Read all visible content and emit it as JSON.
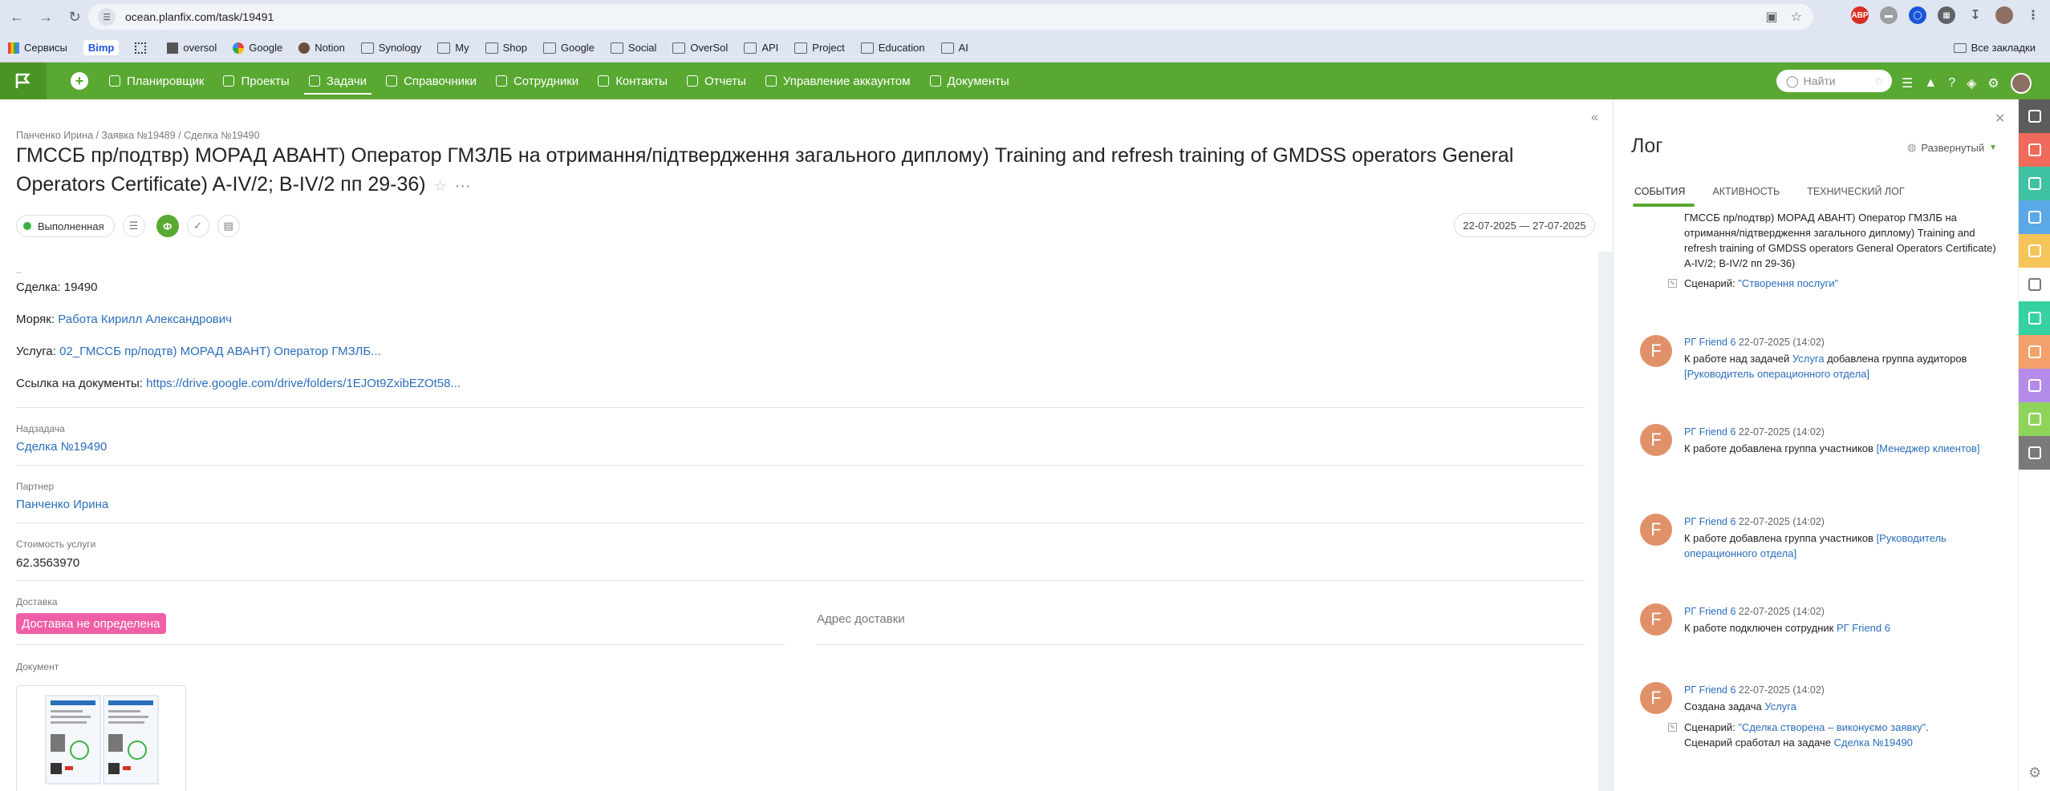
{
  "browser": {
    "url": "ocean.planfix.com/task/19491",
    "bookmarks": [
      "Сервисы",
      "Bimp",
      "oversol",
      "Google",
      "Notion",
      "Synology",
      "My",
      "Shop",
      "Google",
      "Social",
      "OverSol",
      "API",
      "Project",
      "Education",
      "AI"
    ],
    "all_bookmarks": "Все закладки"
  },
  "appbar": {
    "menu": [
      "Планировщик",
      "Проекты",
      "Задачи",
      "Справочники",
      "Сотрудники",
      "Контакты",
      "Отчеты",
      "Управление аккаунтом",
      "Документы"
    ],
    "active": "Задачи",
    "search_placeholder": "Найти"
  },
  "task": {
    "breadcrumb": "Панченко Ирина / Заявка №19489 / Сделка №19490",
    "title": "ГМССБ пр/подтвр) МОРАД АВАНТ) Оператор ГМЗЛБ на отримання/підтвердження загального диплому) Training and refresh training of GMDSS operators General Operators Certificate) A-IV/2; B-IV/2 пп 29-36)",
    "status": "Выполненная",
    "green_button": "Ф",
    "dates": "22-07-2025 — 27-07-2025",
    "ellipsis": "..",
    "deal_label": "Сделка:",
    "deal_value": "19490",
    "sailor_label": "Моряк:",
    "sailor_value": "Работа Кирилл Александрович",
    "service_label": "Услуга:",
    "service_value": "02_ГМССБ пр/подтв) МОРАД АВАНТ) Оператор ГМЗЛБ...",
    "docs_label": "Ссылка на документы:",
    "docs_value": "https://drive.google.com/drive/folders/1EJOt9ZxibEZOt58...",
    "parent_label": "Надзадача",
    "parent_value": "Сделка №19490",
    "partner_label": "Партнер",
    "partner_value": "Панченко Ирина",
    "cost_label": "Стоимость услуги",
    "cost_value": "62.3563970",
    "delivery_label": "Доставка",
    "delivery_value": "Доставка не определена",
    "address_label": "Адрес доставки",
    "document_label": "Документ"
  },
  "log": {
    "title": "Лог",
    "mode": "Развернутый",
    "tabs": [
      "СОБЫТИЯ",
      "АКТИВНОСТЬ",
      "ТЕХНИЧЕСКИЙ ЛОГ"
    ],
    "top_text": "ГМССБ пр/подтвр) МОРАД АВАНТ) Оператор ГМЗЛБ на отримання/підтвердження загального диплому) Training and refresh training of GMDSS operators General Operators Certificate) A-IV/2; B-IV/2 пп 29-36)",
    "top_scenario_prefix": "Сценарий: ",
    "top_scenario_link": "\"Створення послуги\"",
    "entries": [
      {
        "avatar": "F",
        "who": "РГ Friend 6",
        "when": "22-07-2025 (14:02)",
        "text": "К работе над задачей ",
        "link1": "Услуга",
        "text2": " добавлена группа аудиторов ",
        "link2": "[Руководитель операционного отдела]"
      },
      {
        "avatar": "F",
        "who": "РГ Friend 6",
        "when": "22-07-2025 (14:02)",
        "text": "К работе добавлена группа участников ",
        "link1": "[Менеджер клиентов]",
        "text2": "",
        "link2": ""
      },
      {
        "avatar": "F",
        "who": "РГ Friend 6",
        "when": "22-07-2025 (14:02)",
        "text": "К работе добавлена группа участников ",
        "link1": "[Руководитель операционного отдела]",
        "text2": "",
        "link2": ""
      },
      {
        "avatar": "F",
        "who": "РГ Friend 6",
        "when": "22-07-2025 (14:02)",
        "text": "К работе подключен сотрудник ",
        "link1": "РГ Friend 6",
        "text2": "",
        "link2": ""
      },
      {
        "avatar": "F",
        "who": "РГ Friend 6",
        "when": "22-07-2025 (14:02)",
        "text": "Создана задача ",
        "link1": "Услуга",
        "text2": "",
        "link2": ""
      }
    ],
    "last_scenario_prefix": "Сценарий: ",
    "last_scenario_link": "\"Сделка створена – виконуємо заявку\"",
    "last_scenario_suffix": ".",
    "last_scenario_line2": "Сценарий сработал на задаче ",
    "last_scenario_line2_link": "Сделка №19490"
  },
  "strip_colors": [
    "#5c5c5c",
    "#ef6a5a",
    "#3fc1a3",
    "#5aa9e6",
    "#f6c55a",
    "#ffffff",
    "#36d1a3",
    "#f3a06b",
    "#b48be8",
    "#8fd45a",
    "#7a7a7a"
  ],
  "strip_icons": [
    "planfix-icon",
    "mail-icon",
    "flow-icon",
    "docs-icon",
    "bell-icon",
    "clipboard-icon",
    "key-icon",
    "person-icon",
    "chart-icon",
    "send-icon",
    "wave-icon"
  ]
}
